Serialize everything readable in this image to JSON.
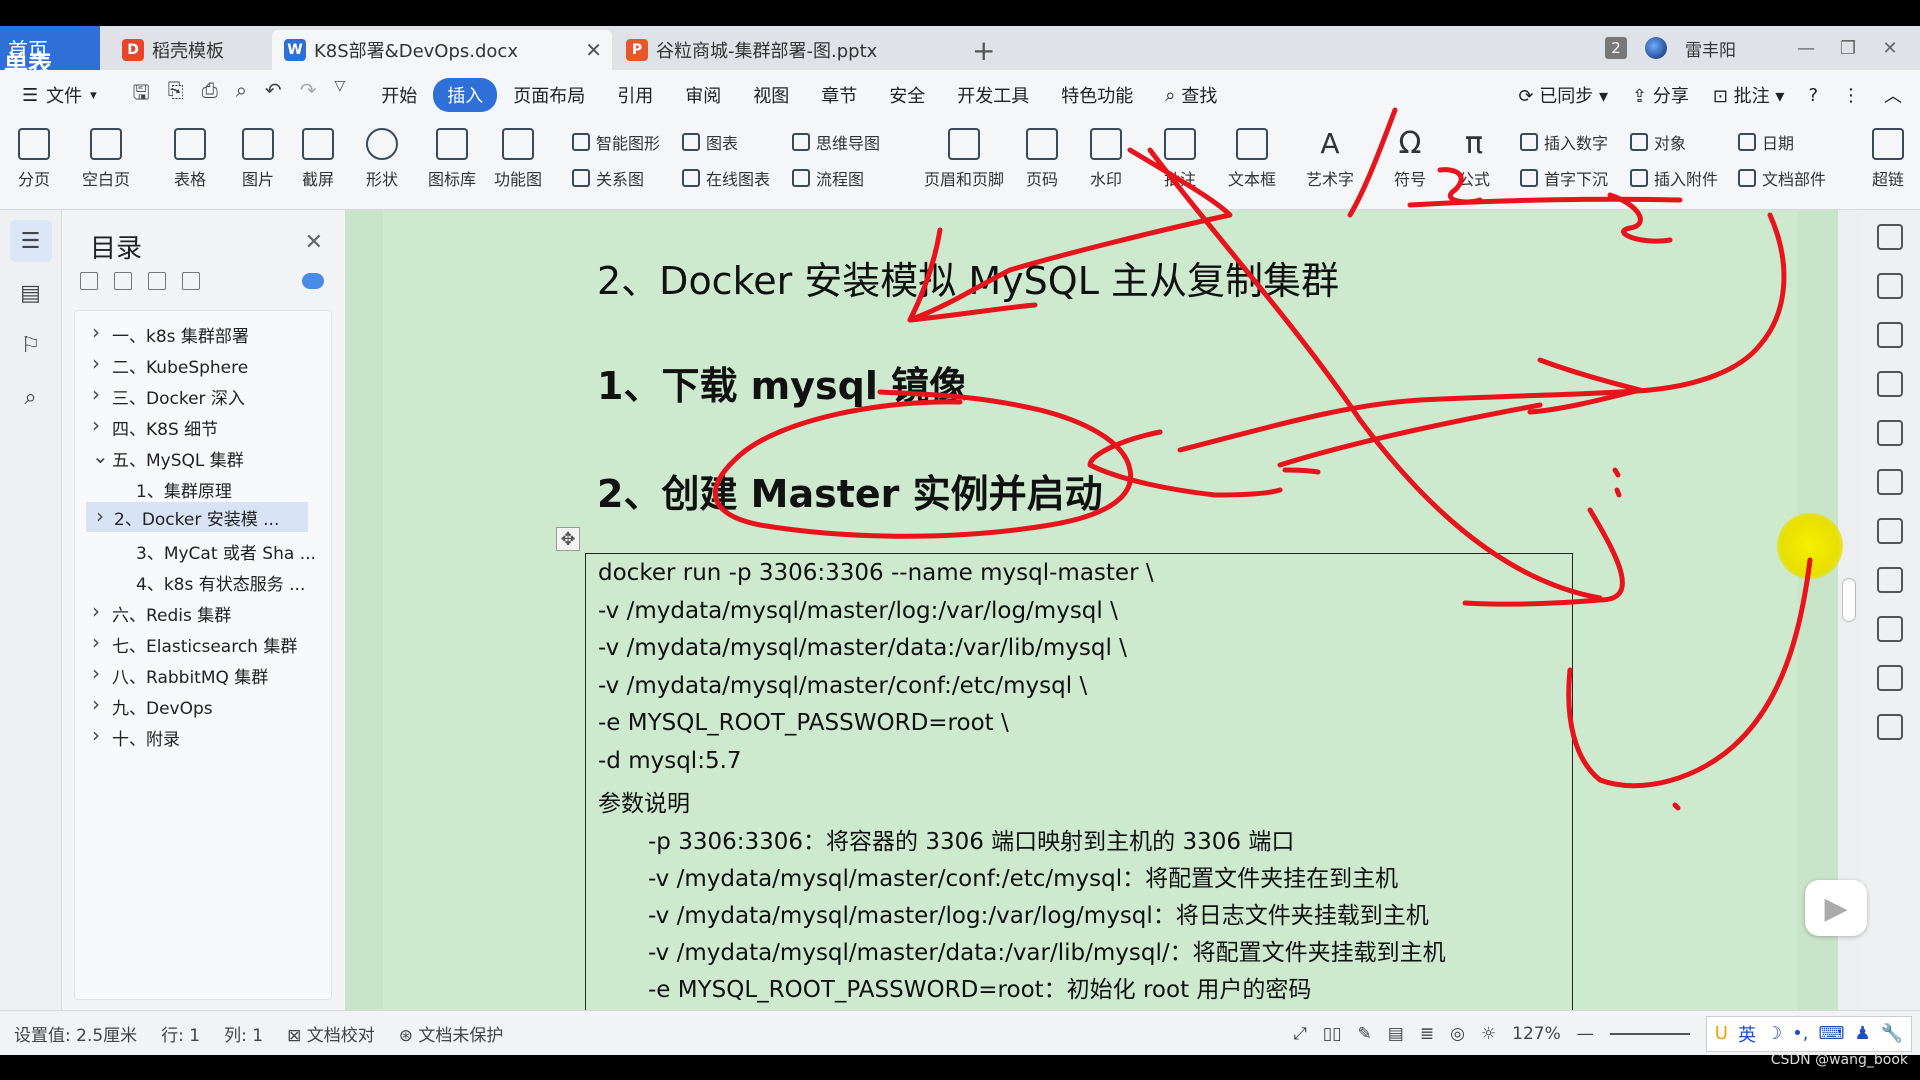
{
  "home_tab": {
    "label": "首页",
    "overlay": "单表300w"
  },
  "tabs": [
    {
      "label": "稻壳模板",
      "icon_color": "#e8452c"
    },
    {
      "label": "K8S部署&DevOps.docx",
      "icon_color": "#2f6fd8",
      "active": true
    },
    {
      "label": "谷粒商城-集群部署-图.pptx",
      "icon_color": "#e8562c"
    }
  ],
  "tabbar_right": {
    "badge": "2",
    "user": "雷丰阳"
  },
  "menu": {
    "file": "文件",
    "items": [
      "开始",
      "插入",
      "页面布局",
      "引用",
      "审阅",
      "视图",
      "章节",
      "安全",
      "开发工具",
      "特色功能"
    ],
    "active": "插入",
    "search": "查找",
    "sync": "已同步",
    "share": "分享",
    "comment": "批注"
  },
  "ribbon": {
    "big": [
      "分页",
      "空白页",
      "表格",
      "图片",
      "截屏",
      "形状",
      "图标库",
      "功能图"
    ],
    "small_col1": [
      "智能图形",
      "关系图"
    ],
    "small_col2": [
      "图表",
      "在线图表"
    ],
    "small_col3": [
      "思维导图",
      "流程图"
    ],
    "big2": [
      "页眉和页脚",
      "页码",
      "水印",
      "批注",
      "文本框",
      "艺术字",
      "符号",
      "公式"
    ],
    "small_col4": [
      "插入数字",
      "首字下沉"
    ],
    "small_col5": [
      "对象",
      "插入附件"
    ],
    "small_col6": [
      "日期",
      "文档部件"
    ],
    "last": "超链"
  },
  "toc": {
    "title": "目录",
    "items": [
      {
        "label": "一、k8s 集群部署",
        "level": 1,
        "expand": "right"
      },
      {
        "label": "二、KubeSphere",
        "level": 1,
        "expand": "right"
      },
      {
        "label": "三、Docker 深入",
        "level": 1,
        "expand": "right"
      },
      {
        "label": "四、K8S 细节",
        "level": 1,
        "expand": "right"
      },
      {
        "label": "五、MySQL 集群",
        "level": 1,
        "expand": "down"
      },
      {
        "label": "1、集群原理",
        "level": 2,
        "expand": ""
      },
      {
        "label": "2、Docker 安装模 ...",
        "level": 2,
        "expand": "right",
        "selected": true
      },
      {
        "label": "3、MyCat 或者 Sha ...",
        "level": 2,
        "expand": ""
      },
      {
        "label": "4、k8s 有状态服务 ...",
        "level": 2,
        "expand": ""
      },
      {
        "label": "六、Redis 集群",
        "level": 1,
        "expand": "right"
      },
      {
        "label": "七、Elasticsearch 集群",
        "level": 1,
        "expand": "right"
      },
      {
        "label": "八、RabbitMQ 集群",
        "level": 1,
        "expand": "right"
      },
      {
        "label": "九、DevOps",
        "level": 1,
        "expand": "right"
      },
      {
        "label": "十、附录",
        "level": 1,
        "expand": "right"
      }
    ]
  },
  "doc": {
    "heading1": "2、Docker 安装模拟 MySQL 主从复制集群",
    "heading2": "1、下载 mysql 镜像",
    "heading3": "2、创建 Master 实例并启动",
    "code_lines": [
      "docker run -p 3306:3306 --name mysql-master \\",
      "-v /mydata/mysql/master/log:/var/log/mysql \\",
      "-v /mydata/mysql/master/data:/var/lib/mysql \\",
      "-v /mydata/mysql/master/conf:/etc/mysql \\",
      "-e MYSQL_ROOT_PASSWORD=root \\",
      "-d mysql:5.7",
      "参数说明"
    ],
    "param_lines": [
      "-p 3306:3306：将容器的 3306 端口映射到主机的 3306 端口",
      "-v /mydata/mysql/master/conf:/etc/mysql：将配置文件夹挂在到主机",
      "-v /mydata/mysql/master/log:/var/log/mysql：将日志文件夹挂载到主机",
      "-v /mydata/mysql/master/data:/var/lib/mysql/：将配置文件夹挂载到主机",
      "-e MYSQL_ROOT_PASSWORD=root：初始化 root 用户的密码"
    ]
  },
  "status": {
    "setting": "设置值: 2.5厘米",
    "row": "行: 1",
    "col": "列: 1",
    "proof": "文档校对",
    "protect": "文档未保护",
    "zoom": "127%",
    "ime": "英"
  },
  "watermark": "CSDN @wang_book",
  "colors": {
    "accent": "#2f6fd8",
    "doc_bg": "#cdeacf",
    "ink": "#e8141c"
  }
}
